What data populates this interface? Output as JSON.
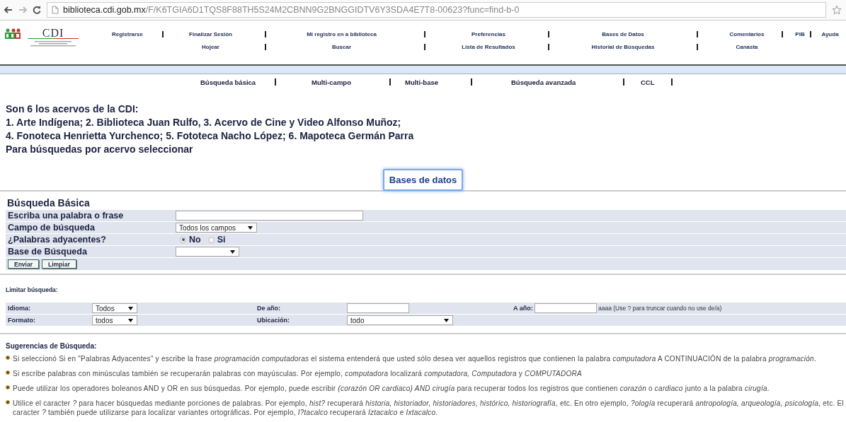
{
  "browser": {
    "url_host": "biblioteca.cdi.gob.mx",
    "url_path": "/F/K6TGIA6D1TQS8F88TH5S24M2CBNN9G2BNGGIDTV6Y3SDA4E7T8-00623?func=find-b-0"
  },
  "logo": {
    "text": "CDI"
  },
  "nav": [
    {
      "links": [
        "Registrarse"
      ]
    },
    {
      "links": [
        "Finalizar Sesión",
        "Hojear"
      ]
    },
    {
      "links": [
        "Mi registro en a biblioteca",
        "Buscar"
      ]
    },
    {
      "links": [
        "Preferencias",
        "Lista de Resultados"
      ]
    },
    {
      "links": [
        "Bases de Datos",
        "Historial de Búsquedas"
      ]
    },
    {
      "links": [
        "Comentarios",
        "Canasta"
      ]
    },
    {
      "links": [
        "PIB"
      ]
    },
    {
      "links": [
        "Ayuda"
      ]
    }
  ],
  "search_tabs": [
    "Búsqueda básica",
    "Multi-campo",
    "Multi-base",
    "Búsqueda avanzada",
    "CCL"
  ],
  "intro": [
    "Son 6 los acervos de la CDI:",
    "1. Arte Indígena; 2. Biblioteca Juan Rulfo, 3. Acervo de Cine y Video Alfonso Muñoz;",
    "4. Fonoteca Henrietta Yurchenco; 5. Fototeca Nacho López; 6. Mapoteca Germán Parra",
    "Para búsquedas por acervo seleccionar"
  ],
  "databases_button": "Bases de datos",
  "basic_search": {
    "title": "Búsqueda Básica",
    "rows": [
      {
        "kind": "text",
        "label": "Escriba una palabra o frase"
      },
      {
        "kind": "select",
        "label": "Campo de búsqueda",
        "value": "Todos los campos"
      },
      {
        "kind": "radio",
        "label": "¿Palabras adyacentes?",
        "options": [
          {
            "label": "No",
            "selected": true
          },
          {
            "label": "Si",
            "selected": false
          }
        ]
      },
      {
        "kind": "select",
        "label": "Base de Búsqueda"
      }
    ],
    "buttons": [
      "Enviar",
      "Limpiar"
    ]
  },
  "limits": {
    "title": "Limitar búsqueda:",
    "rows": [
      [
        {
          "kind": "label",
          "text": "Idioma:"
        },
        {
          "kind": "select",
          "value": "Todos"
        },
        {
          "kind": "label",
          "text": "De año:"
        },
        {
          "kind": "text"
        },
        {
          "kind": "label",
          "text": "A año:"
        },
        {
          "kind": "text"
        },
        {
          "kind": "hint",
          "text": "aaaa (Use ? para truncar cuando no use de/a)"
        }
      ],
      [
        {
          "kind": "label",
          "text": "Formato:"
        },
        {
          "kind": "select",
          "value": "todos"
        },
        {
          "kind": "label",
          "text": "Ubicación:"
        },
        {
          "kind": "select",
          "value": "todo"
        }
      ]
    ]
  },
  "tips": {
    "title": "Sugerencias de Búsqueda:",
    "items": [
      "Si seleccionó Si en \"Palabras Adyacentes\" y escribe la frase *programación computadoras* el sistema entenderá que usted sólo desea ver aquellos registros que contienen la palabra *computadora* A CONTINUACIÓN de la palabra *programación*.",
      "Si escribe palabras con minúsculas también se recuperarán palabras con mayúsculas. Por ejemplo, *computadora* localizará *computadora, Computadora* y *COMPUTADORA*",
      "Puede utilizar los operadores boleanos AND y OR en sus búsquedas. Por ejemplo, puede escribir *(corazón OR cardiaco) AND cirugía* para recuperar todos los registros que contienen *corazón* o *cardiaco* junto a la palabra *cirugía*.",
      "Utilice el caracter *?* para hacer búsquedas mediante porciones de palabras. Por ejemplo, *hist?* recuperará *historia, historiador, historiadores, histórico, historiografía*, etc. En otro ejemplo, *?ología* recuperará *antropología, arqueología, psicología*, etc. El caracter *?* también puede utilizarse para localizar variantes ortográficas. Por ejemplo, *I?tacalco* recuperará *Iztacalco* e *Ixtacalco*."
    ]
  }
}
